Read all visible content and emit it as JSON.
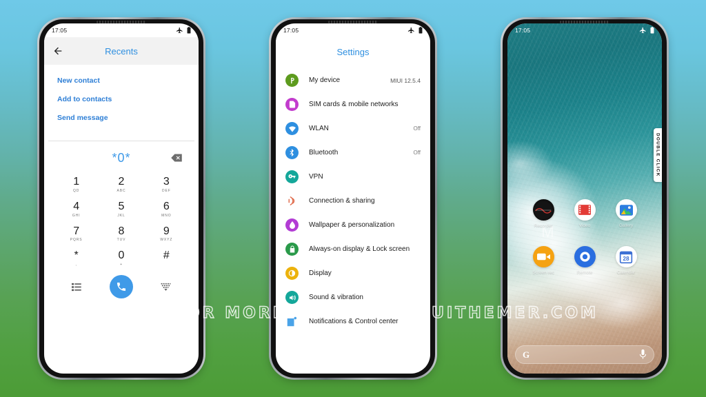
{
  "background": {
    "top_color": "#6fc9e8",
    "bottom_color": "#4c9c36"
  },
  "watermark": {
    "text": "VISIT FOR MORE THEMES  -  MIUITHEMER.COM"
  },
  "status_bar": {
    "time": "17:05",
    "airplane_icon": "airplane-mode-icon",
    "battery_icon": "battery-icon"
  },
  "phone1": {
    "screen_name": "dialer-recents",
    "header": {
      "back_icon": "back-arrow-icon",
      "title": "Recents"
    },
    "actions": [
      {
        "label": "New contact"
      },
      {
        "label": "Add to contacts"
      },
      {
        "label": "Send message"
      }
    ],
    "dialer": {
      "number": "*0*",
      "backspace_icon": "backspace-icon",
      "keys": [
        {
          "digit": "1",
          "sub": "QD"
        },
        {
          "digit": "2",
          "sub": "ABC"
        },
        {
          "digit": "3",
          "sub": "DEF"
        },
        {
          "digit": "4",
          "sub": "GHI"
        },
        {
          "digit": "5",
          "sub": "JKL"
        },
        {
          "digit": "6",
          "sub": "MNO"
        },
        {
          "digit": "7",
          "sub": "PQRS"
        },
        {
          "digit": "8",
          "sub": "TUV"
        },
        {
          "digit": "9",
          "sub": "WXYZ"
        },
        {
          "digit": "*",
          "sub": ","
        },
        {
          "digit": "0",
          "sub": "+"
        },
        {
          "digit": "#",
          "sub": ""
        }
      ],
      "bottom": {
        "left_icon": "call-log-list-icon",
        "call_icon": "phone-call-icon",
        "right_icon": "hide-keypad-icon",
        "accent_color": "#3f9ae8"
      }
    }
  },
  "phone2": {
    "screen_name": "settings",
    "header": {
      "title": "Settings"
    },
    "items": [
      {
        "icon": "my-device-icon",
        "label": "My device",
        "value": "MIUI 12.5.4",
        "color": "#5d9b1e"
      },
      {
        "icon": "sim-card-icon",
        "label": "SIM cards & mobile networks",
        "value": "",
        "color": "#c23ccd"
      },
      {
        "icon": "wlan-icon",
        "label": "WLAN",
        "value": "Off",
        "color": "#2e8fe0"
      },
      {
        "icon": "bluetooth-icon",
        "label": "Bluetooth",
        "value": "Off",
        "color": "#2e8fe0"
      },
      {
        "icon": "vpn-key-icon",
        "label": "VPN",
        "value": "",
        "color": "#14a79a"
      },
      {
        "icon": "connection-sharing-icon",
        "label": "Connection & sharing",
        "value": "",
        "color": "#e06a4a"
      },
      {
        "icon": "wallpaper-icon",
        "label": "Wallpaper & personalization",
        "value": "",
        "color": "#b23cd4"
      },
      {
        "icon": "lock-screen-icon",
        "label": "Always-on display & Lock screen",
        "value": "",
        "color": "#2a9a4a"
      },
      {
        "icon": "display-icon",
        "label": "Display",
        "value": "",
        "color": "#ecb20c"
      },
      {
        "icon": "sound-vibration-icon",
        "label": "Sound & vibration",
        "value": "",
        "color": "#14a79a"
      },
      {
        "icon": "notifications-icon",
        "label": "Notifications & Control center",
        "value": "",
        "color": "#4aa3e8"
      }
    ]
  },
  "phone3": {
    "screen_name": "home-screen",
    "wallpaper": "ocean-wave-aerial",
    "watermark_letter": "M",
    "side_tab": {
      "label": "DOUBLE CLICK"
    },
    "apps": [
      {
        "icon": "recorder-icon",
        "label": "Recorder"
      },
      {
        "icon": "video-icon",
        "label": "Video"
      },
      {
        "icon": "gallery-icon",
        "label": "Gallery"
      },
      {
        "icon": "screen-recorder-icon",
        "label": "Screen rec"
      },
      {
        "icon": "remote-control-icon",
        "label": "Remote"
      },
      {
        "icon": "calendar-icon",
        "label": "Calendar",
        "day": "28"
      }
    ],
    "search": {
      "logo": "google-g-icon",
      "mic_icon": "microphone-icon",
      "placeholder": ""
    }
  }
}
